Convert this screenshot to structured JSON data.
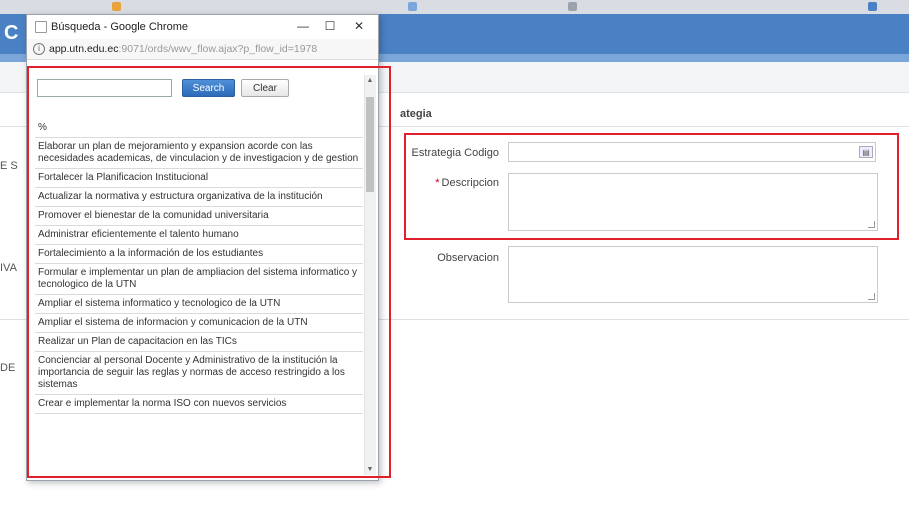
{
  "popup": {
    "window_title": "Búsqueda - Google Chrome",
    "url_host": "app.utn.edu.ec",
    "url_path": ":9071/ords/wwv_flow.ajax?p_flow_id=1978",
    "controls": {
      "minimize": "—",
      "maximize": "☐",
      "close": "✕"
    },
    "search": {
      "value": "",
      "placeholder": "",
      "search_label": "Search",
      "clear_label": "Clear"
    },
    "results": [
      "%",
      "Elaborar un plan de mejoramiento y expansion acorde con las necesidades academicas, de vinculacion y de investigacion y de gestion",
      "Fortalecer la Planificacion Institucional",
      "Actualizar la normativa y estructura organizativa de la institución",
      "Promover el bienestar de la comunidad universitaria",
      "Administrar eficientemente el talento humano",
      "Fortalecimiento a la información de los estudiantes",
      "Formular e implementar un plan de ampliacion del sistema informatico y tecnologico de la UTN",
      "Ampliar el sistema informatico y tecnologico de la UTN",
      "Ampliar el sistema de informacion y comunicacion de la UTN",
      "Realizar un Plan de capacitacion en las TICs",
      "Concienciar al personal Docente y Administrativo de la institución la importancia de seguir las reglas y normas de acceso restringido a los sistemas",
      "Crear e implementar la norma ISO con nuevos servicios"
    ]
  },
  "app": {
    "logo": "C",
    "section_title": "ategia",
    "side_labels": [
      "E S",
      "IVA",
      "DE"
    ]
  },
  "form": {
    "estrategia_codigo_label": "Estrategia Codigo",
    "estrategia_codigo_value": "",
    "descripcion_label": "Descripcion",
    "descripcion_required_marker": "*",
    "descripcion_value": "",
    "observacion_label": "Observacion",
    "observacion_value": ""
  },
  "browser_tabs": [
    "",
    "",
    "",
    "",
    "",
    ""
  ],
  "colors": {
    "app_header": "#4a81c4",
    "highlight": "#e0202a",
    "search_button": "#2c6bb8"
  }
}
